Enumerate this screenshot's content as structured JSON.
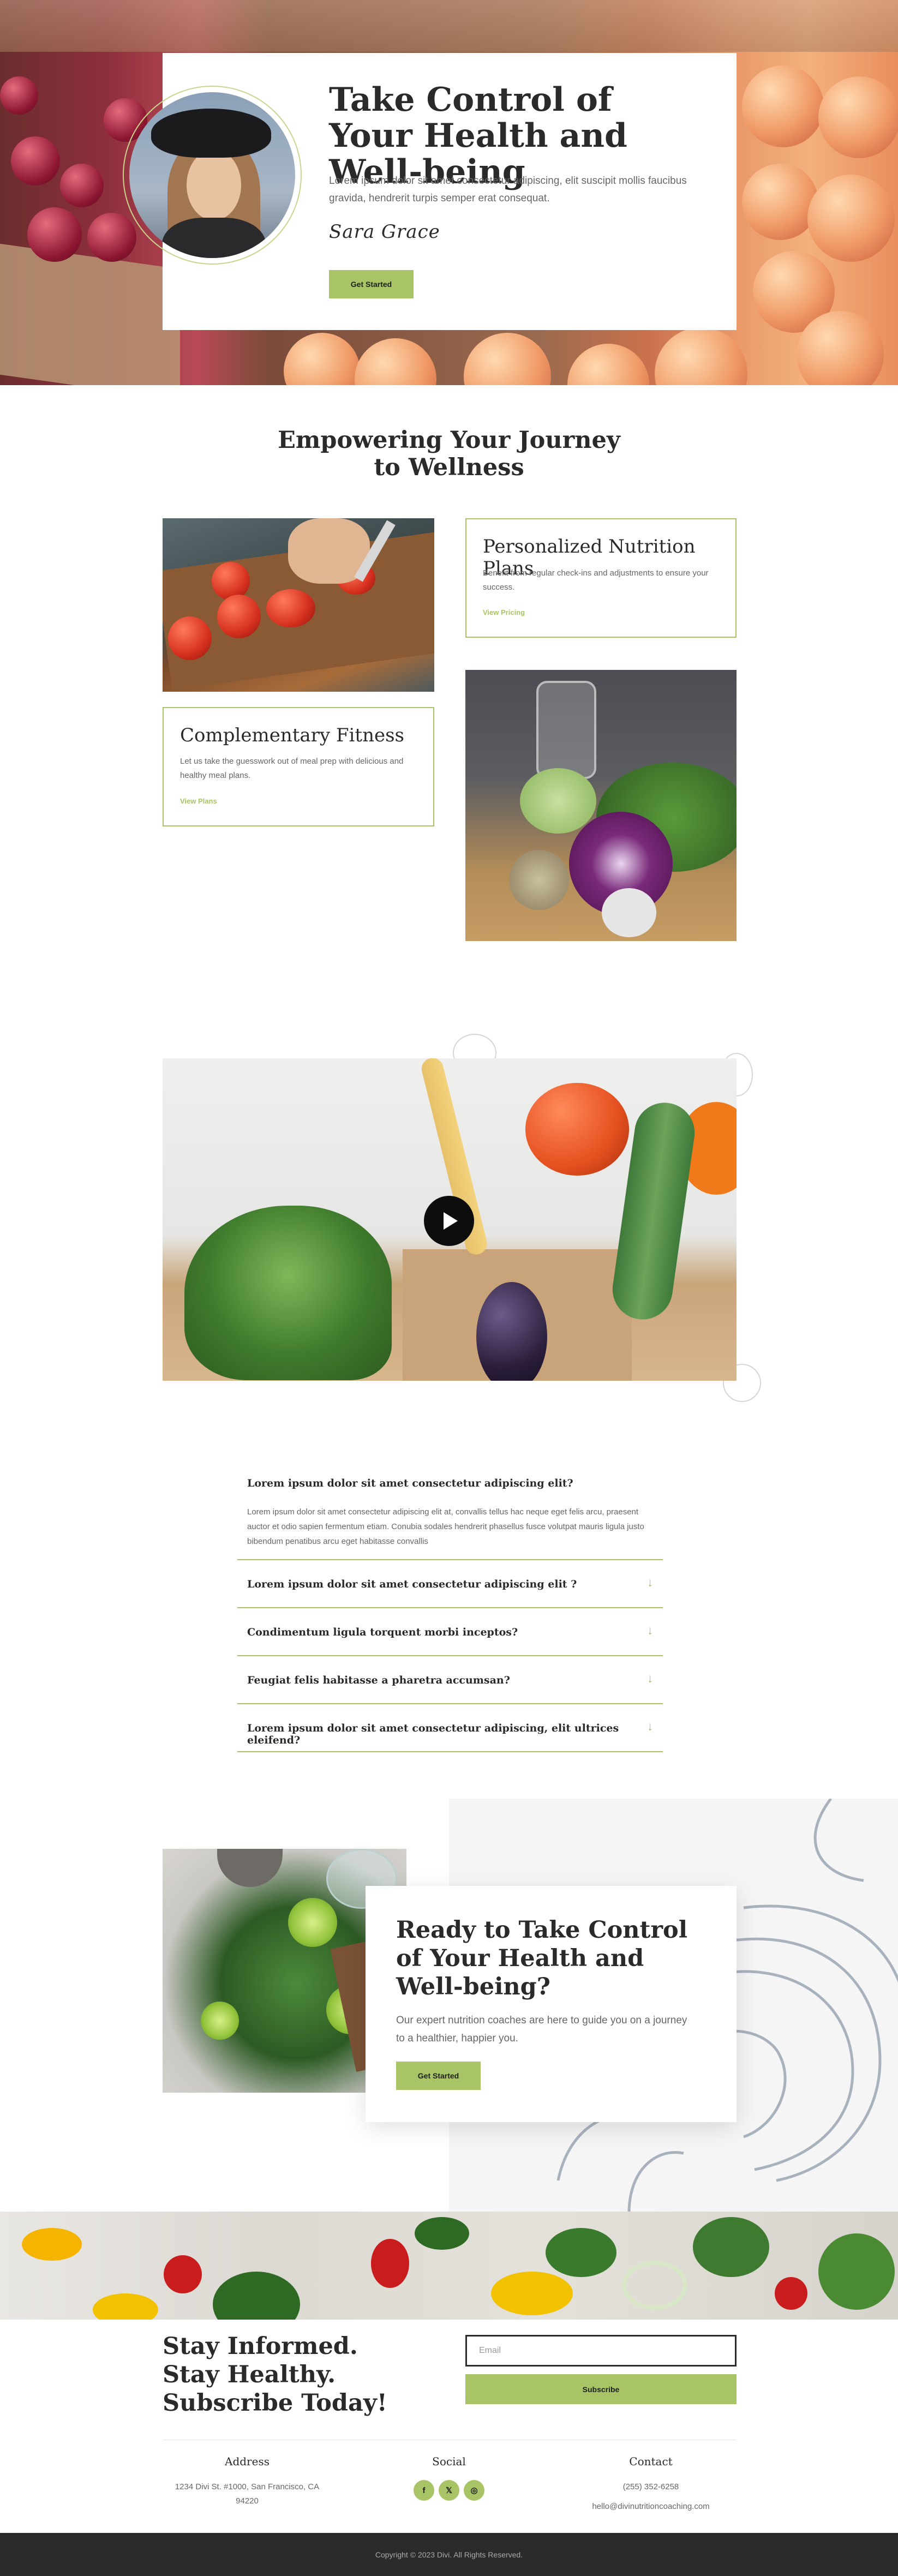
{
  "hero": {
    "title": "Take Control of Your Health and Well-being",
    "text": "Lorem ipsum dolor sit amet consectetur adipiscing, elit suscipit mollis faucibus gravida, hendrerit turpis semper erat consequat.",
    "signature": "Sara Grace",
    "button": "Get Started"
  },
  "services": {
    "title": "Empowering Your Journey to Wellness",
    "cards": [
      {
        "title": "Personalized Nutrition Plans",
        "text": "Benefit from regular check-ins and adjustments to ensure your success.",
        "link": "View Pricing"
      },
      {
        "title": "Complementary Fitness",
        "text": "Let us take the guesswork out of meal prep with delicious and healthy meal plans.",
        "link": "View Plans"
      }
    ]
  },
  "video": {
    "play_icon": "play-icon"
  },
  "faq": {
    "open": {
      "question": "Lorem ipsum dolor sit amet consectetur adipiscing elit?",
      "answer": "Lorem ipsum dolor sit amet consectetur adipiscing elit at, convallis tellus hac neque eget felis arcu, praesent auctor et odio sapien fermentum etiam. Conubia sodales hendrerit phasellus fusce volutpat mauris ligula justo bibendum penatibus arcu eget habitasse convallis"
    },
    "items": [
      "Lorem ipsum dolor sit amet consectetur adipiscing elit ?",
      "Condimentum ligula torquent morbi inceptos?",
      "Feugiat felis habitasse a pharetra accumsan?",
      "Lorem ipsum dolor sit amet consectetur adipiscing, elit ultrices eleifend?"
    ],
    "chevron": "↓"
  },
  "cta": {
    "title": "Ready to Take Control of Your Health and Well-being?",
    "text": "Our expert nutrition coaches are here to guide you on a journey to a healthier, happier you.",
    "button": "Get Started"
  },
  "newsletter": {
    "title": "Stay Informed. Stay Healthy. Subscribe Today!",
    "email_placeholder": "Email",
    "button": "Subscribe"
  },
  "footer": {
    "address": {
      "title": "Address",
      "lines": [
        "1234 Divi St. #1000, San Francisco, CA",
        "94220"
      ]
    },
    "social": {
      "title": "Social",
      "icons": [
        "f",
        "𝕏",
        "◎"
      ]
    },
    "contact": {
      "title": "Contact",
      "phone": "(255) 352-6258",
      "email": "hello@divinutritioncoaching.com"
    },
    "copyright": "Copyright © 2023 Divi. All Rights Reserved."
  },
  "colors": {
    "accent": "#a8c466",
    "dark": "#2b2b2b",
    "text": "#666666"
  }
}
